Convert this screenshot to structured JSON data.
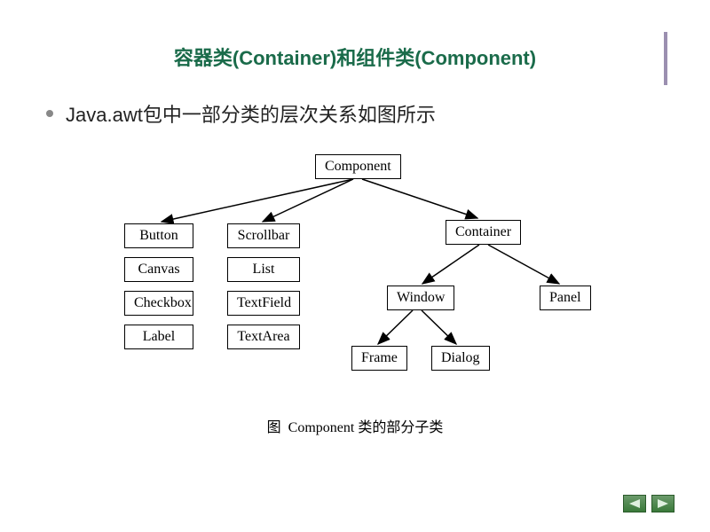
{
  "title": "容器类(Container)和组件类(Component)",
  "bullet_text": "Java.awt包中一部分类的层次关系如图所示",
  "caption_prefix": "图",
  "caption_text": "Component 类的部分子类",
  "chart_data": {
    "type": "tree",
    "title": "Component 类的部分子类",
    "root": "Component",
    "nodes": {
      "Component": {
        "children": [
          "Button",
          "Scrollbar",
          "Container"
        ]
      },
      "Button": {
        "siblings_column": [
          "Button",
          "Canvas",
          "Checkbox",
          "Label"
        ]
      },
      "Scrollbar": {
        "siblings_column": [
          "Scrollbar",
          "List",
          "TextField",
          "TextArea"
        ]
      },
      "Container": {
        "children": [
          "Window",
          "Panel"
        ]
      },
      "Window": {
        "children": [
          "Frame",
          "Dialog"
        ]
      },
      "Panel": {},
      "Frame": {},
      "Dialog": {},
      "Canvas": {},
      "Checkbox": {},
      "Label": {},
      "List": {},
      "TextField": {},
      "TextArea": {}
    },
    "columns_left": [
      [
        "Button",
        "Canvas",
        "Checkbox",
        "Label"
      ],
      [
        "Scrollbar",
        "List",
        "TextField",
        "TextArea"
      ]
    ]
  },
  "labels": {
    "Component": "Component",
    "Button": "Button",
    "Canvas": "Canvas",
    "Checkbox": "Checkbox",
    "Label": "Label",
    "Scrollbar": "Scrollbar",
    "List": "List",
    "TextField": "TextField",
    "TextArea": "TextArea",
    "Container": "Container",
    "Window": "Window",
    "Panel": "Panel",
    "Frame": "Frame",
    "Dialog": "Dialog"
  },
  "colors": {
    "title": "#1a6b4a",
    "nav_button": "#3a7a3a"
  }
}
